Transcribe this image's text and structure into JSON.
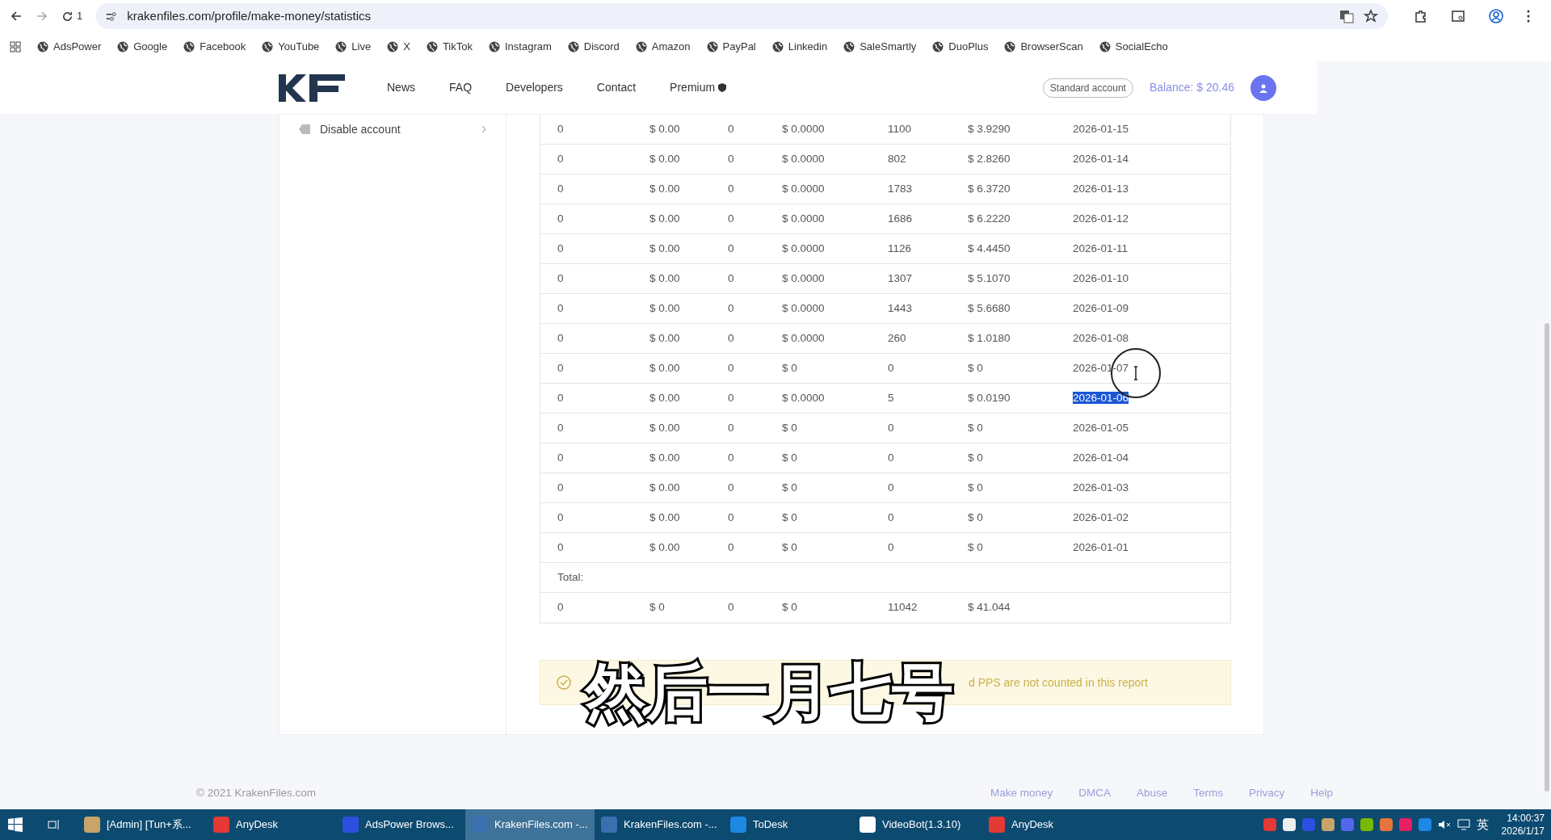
{
  "browser": {
    "tab_count": "1",
    "url": "krakenfiles.com/profile/make-money/statistics"
  },
  "bookmarks": [
    "AdsPower",
    "Google",
    "Facebook",
    "YouTube",
    "Live",
    "X",
    "TikTok",
    "Instagram",
    "Discord",
    "Amazon",
    "PayPal",
    "Linkedin",
    "SaleSmartly",
    "DuoPlus",
    "BrowserScan",
    "SocialEcho"
  ],
  "header": {
    "nav": [
      "News",
      "FAQ",
      "Developers",
      "Contact",
      "Premium"
    ],
    "account_badge": "Standard account",
    "balance": "Balance: $ 20.46"
  },
  "sidebar": {
    "items": [
      "Disable account"
    ]
  },
  "table": {
    "rows": [
      {
        "cells": [
          "0",
          "$ 0.00",
          "0",
          "$ 0.0000",
          "1100",
          "$ 3.9290",
          "2026-01-15"
        ],
        "highlighted": false
      },
      {
        "cells": [
          "0",
          "$ 0.00",
          "0",
          "$ 0.0000",
          "802",
          "$ 2.8260",
          "2026-01-14"
        ],
        "highlighted": false
      },
      {
        "cells": [
          "0",
          "$ 0.00",
          "0",
          "$ 0.0000",
          "1783",
          "$ 6.3720",
          "2026-01-13"
        ],
        "highlighted": false
      },
      {
        "cells": [
          "0",
          "$ 0.00",
          "0",
          "$ 0.0000",
          "1686",
          "$ 6.2220",
          "2026-01-12"
        ],
        "highlighted": false
      },
      {
        "cells": [
          "0",
          "$ 0.00",
          "0",
          "$ 0.0000",
          "1126",
          "$ 4.4450",
          "2026-01-11"
        ],
        "highlighted": false
      },
      {
        "cells": [
          "0",
          "$ 0.00",
          "0",
          "$ 0.0000",
          "1307",
          "$ 5.1070",
          "2026-01-10"
        ],
        "highlighted": false
      },
      {
        "cells": [
          "0",
          "$ 0.00",
          "0",
          "$ 0.0000",
          "1443",
          "$ 5.6680",
          "2026-01-09"
        ],
        "highlighted": false
      },
      {
        "cells": [
          "0",
          "$ 0.00",
          "0",
          "$ 0.0000",
          "260",
          "$ 1.0180",
          "2026-01-08"
        ],
        "highlighted": false
      },
      {
        "cells": [
          "0",
          "$ 0.00",
          "0",
          "$ 0",
          "0",
          "$ 0",
          "2026-01-07"
        ],
        "highlighted": false
      },
      {
        "cells": [
          "0",
          "$ 0.00",
          "0",
          "$ 0.0000",
          "5",
          "$ 0.0190",
          "2026-01-06"
        ],
        "highlighted": true
      },
      {
        "cells": [
          "0",
          "$ 0.00",
          "0",
          "$ 0",
          "0",
          "$ 0",
          "2026-01-05"
        ],
        "highlighted": false
      },
      {
        "cells": [
          "0",
          "$ 0.00",
          "0",
          "$ 0",
          "0",
          "$ 0",
          "2026-01-04"
        ],
        "highlighted": false
      },
      {
        "cells": [
          "0",
          "$ 0.00",
          "0",
          "$ 0",
          "0",
          "$ 0",
          "2026-01-03"
        ],
        "highlighted": false
      },
      {
        "cells": [
          "0",
          "$ 0.00",
          "0",
          "$ 0",
          "0",
          "$ 0",
          "2026-01-02"
        ],
        "highlighted": false
      },
      {
        "cells": [
          "0",
          "$ 0.00",
          "0",
          "$ 0",
          "0",
          "$ 0",
          "2026-01-01"
        ],
        "highlighted": false
      }
    ],
    "total_label": "Total:",
    "total": [
      "0",
      "$ 0",
      "0",
      "$ 0",
      "11042",
      "$ 41.044"
    ]
  },
  "notice": {
    "text": "d PPS are not counted in this report"
  },
  "subtitle": "然后一月七号",
  "footer": {
    "copyright": "© 2021 KrakenFiles.com",
    "links": [
      "Make money",
      "DMCA",
      "Abuse",
      "Terms",
      "Privacy",
      "Help"
    ]
  },
  "taskbar": {
    "items": [
      {
        "label": "[Admin] [Tun+系...",
        "color": "#c9a46a",
        "selected": false
      },
      {
        "label": "AnyDesk",
        "color": "#e53935",
        "selected": false
      },
      {
        "label": "AdsPower Brows...",
        "color": "#2b50e0",
        "selected": false
      },
      {
        "label": "KrakenFiles.com -...",
        "color": "#3a6fb0",
        "selected": true
      },
      {
        "label": "KrakenFiles.com -...",
        "color": "#3a6fb0",
        "selected": false
      },
      {
        "label": "ToDesk",
        "color": "#1e88e5",
        "selected": false
      },
      {
        "label": "VideoBot(1.3.10)",
        "color": "#ffffff",
        "selected": false
      },
      {
        "label": "AnyDesk",
        "color": "#e53935",
        "selected": false
      }
    ],
    "ime": "英",
    "time": "14:00:37",
    "date": "2026/1/17"
  }
}
